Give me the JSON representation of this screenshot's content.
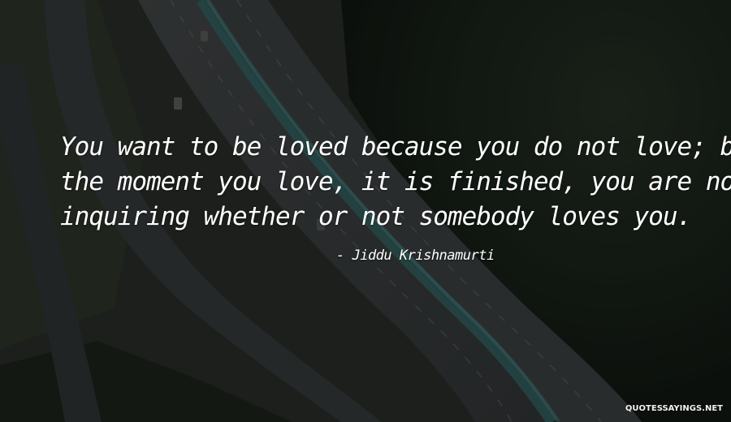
{
  "background": {
    "scene": "aerial highway photo",
    "colors": {
      "road": "#484c4d",
      "median_rail": "#376f6f",
      "forest_dark": "#172018",
      "forest_mid": "#283429",
      "grass": "#3a4233"
    }
  },
  "quote": {
    "lines": [
      "You want to be loved because you do not love; but",
      "the moment you love, it is finished, you are no longer",
      "inquiring whether or not somebody loves you."
    ],
    "author": "- Jiddu Krishnamurti"
  },
  "watermark": "QUOTESSAYINGS.NET"
}
